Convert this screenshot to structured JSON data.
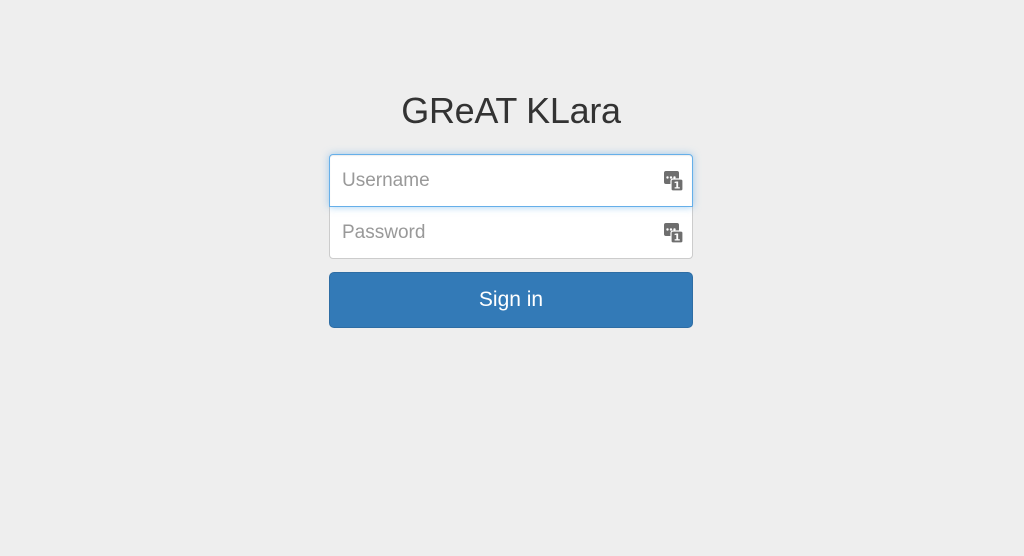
{
  "app": {
    "title": "GReAT KLara"
  },
  "form": {
    "username": {
      "value": "",
      "placeholder": "Username",
      "icon": "password-manager-key-icon"
    },
    "password": {
      "value": "",
      "placeholder": "Password",
      "icon": "password-manager-key-icon"
    },
    "submit_label": "Sign in"
  },
  "colors": {
    "background": "#eeeeee",
    "primary_button": "#337ab7",
    "focus_border": "#66afe9",
    "title_text": "#333333",
    "placeholder_text": "#999999"
  }
}
